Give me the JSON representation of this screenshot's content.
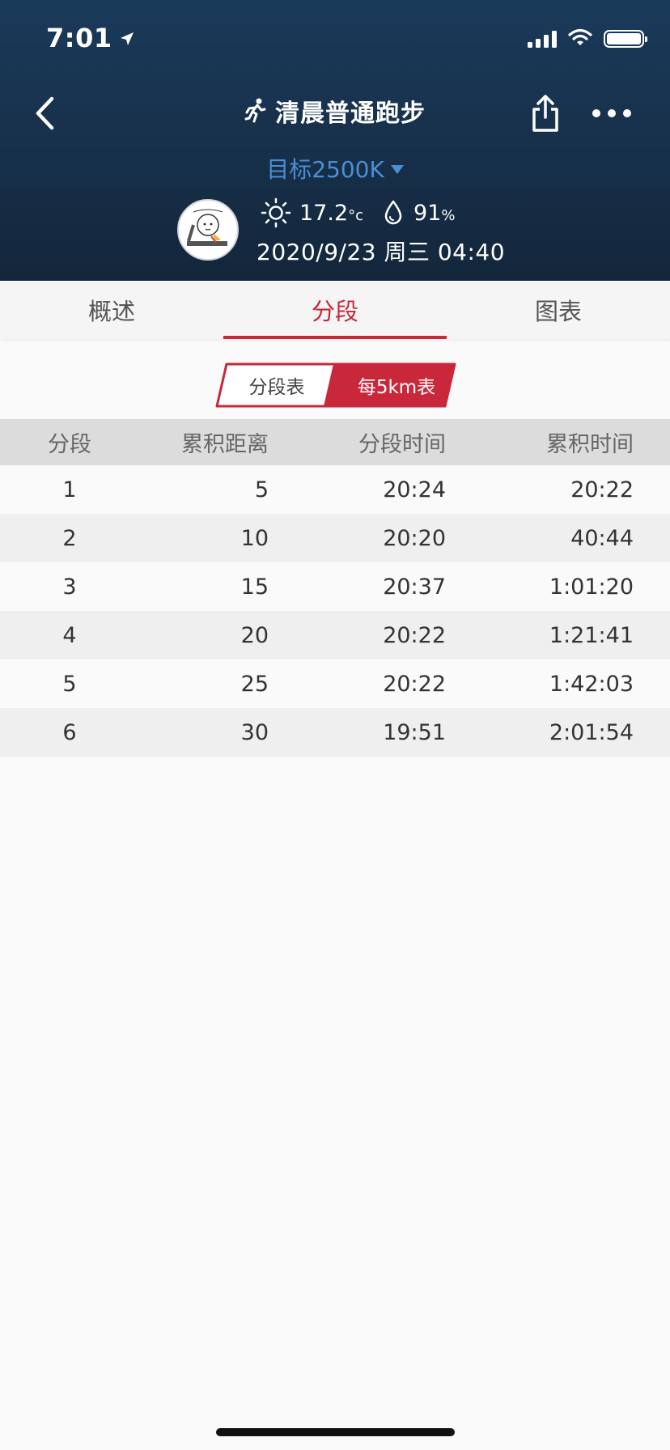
{
  "status_bar": {
    "time": "7:01"
  },
  "header": {
    "title": "清晨普通跑步",
    "goal": "目标2500K",
    "temperature": "17.2",
    "temperature_unit": "°c",
    "humidity": "91",
    "humidity_unit": "%",
    "datetime": "2020/9/23 周三 04:40"
  },
  "tabs": [
    {
      "label": "概述",
      "active": false
    },
    {
      "label": "分段",
      "active": true
    },
    {
      "label": "图表",
      "active": false
    }
  ],
  "segment_toggle": {
    "option_a": "分段表",
    "option_b": "每5km表",
    "selected": "option_b"
  },
  "table": {
    "columns": [
      "分段",
      "累积距离",
      "分段时间",
      "累积时间"
    ],
    "rows": [
      [
        "1",
        "5",
        "20:24",
        "20:22"
      ],
      [
        "2",
        "10",
        "20:20",
        "40:44"
      ],
      [
        "3",
        "15",
        "20:37",
        "1:01:20"
      ],
      [
        "4",
        "20",
        "20:22",
        "1:21:41"
      ],
      [
        "5",
        "25",
        "20:22",
        "1:42:03"
      ],
      [
        "6",
        "30",
        "19:51",
        "2:01:54"
      ]
    ]
  },
  "colors": {
    "accent": "#c8283a",
    "goal": "#4a8fd3",
    "header_bg": "#17304a"
  }
}
